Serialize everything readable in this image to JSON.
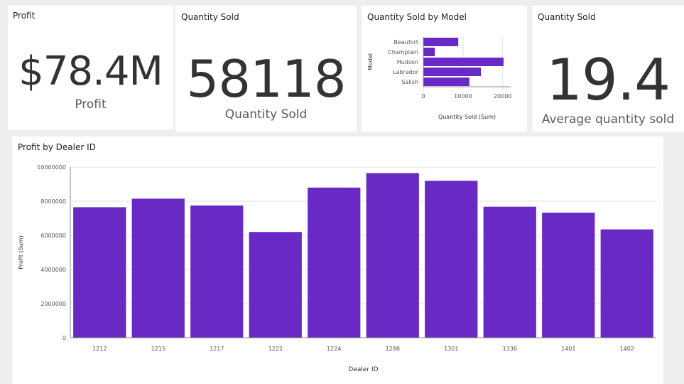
{
  "cards": {
    "profit": {
      "title": "Profit",
      "value": "$78.4M",
      "label": "Profit"
    },
    "quantity": {
      "title": "Quantity Sold",
      "value": "58118",
      "label": "Quantity Sold"
    },
    "model_chart": {
      "title": "Quantity Sold by Model"
    },
    "average": {
      "title": "Quantity Sold",
      "value": "19.4",
      "label": "Average quantity sold"
    },
    "dealer_chart": {
      "title": "Profit by Dealer ID"
    }
  },
  "colors": {
    "bar": "#6929c4",
    "grid": "#e0e0e0",
    "axis": "#8d8d8d"
  },
  "chart_data": [
    {
      "type": "bar",
      "orientation": "horizontal",
      "title": "Quantity Sold by Model",
      "categories": [
        "Beaufort",
        "Champlain",
        "Hudson",
        "Labrador",
        "Salish"
      ],
      "values": [
        8800,
        2900,
        20200,
        14500,
        11600
      ],
      "xlabel": "Quantity Sold (Sum)",
      "ylabel": "Model",
      "xlim": [
        0,
        22000
      ],
      "xticks": [
        "0",
        "10000",
        "20000"
      ],
      "xtick_values": [
        0,
        10000,
        20000
      ],
      "grid": true,
      "legend": "none"
    },
    {
      "type": "bar",
      "title": "Profit by Dealer ID",
      "categories": [
        "1212",
        "1215",
        "1217",
        "1222",
        "1224",
        "1288",
        "1301",
        "1336",
        "1401",
        "1402"
      ],
      "values": [
        7650000,
        8150000,
        7750000,
        6200000,
        8800000,
        9650000,
        9200000,
        7680000,
        7330000,
        6350000
      ],
      "xlabel": "Dealer ID",
      "ylabel": "Profit (Sum)",
      "ylim": [
        0,
        10000000
      ],
      "yticks": [
        "0",
        "2000000",
        "4000000",
        "6000000",
        "8000000",
        "10000000"
      ],
      "ytick_values": [
        0,
        2000000,
        4000000,
        6000000,
        8000000,
        10000000
      ],
      "grid": true,
      "legend": "none"
    }
  ]
}
